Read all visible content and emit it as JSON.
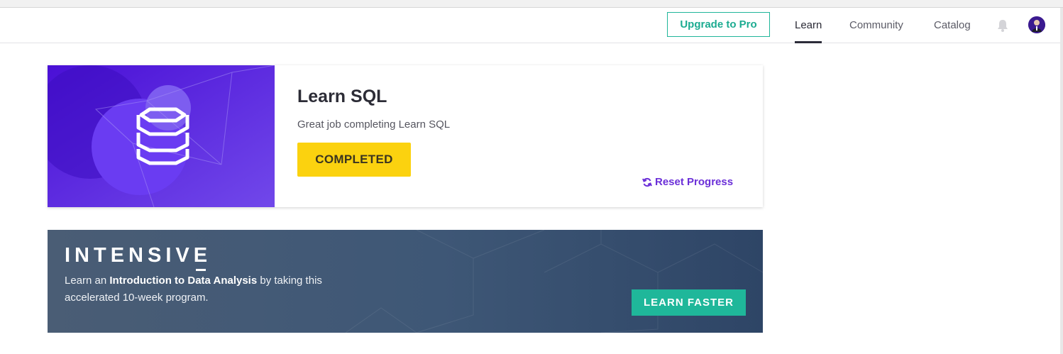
{
  "header": {
    "upgrade_label": "Upgrade to Pro",
    "nav": [
      {
        "label": "Learn",
        "active": true
      },
      {
        "label": "Community",
        "active": false
      },
      {
        "label": "Catalog",
        "active": false
      }
    ],
    "bell_icon": "bell-icon",
    "avatar_icon": "user-avatar"
  },
  "course_card": {
    "title": "Learn SQL",
    "subtitle": "Great job completing Learn SQL",
    "status_label": "COMPLETED",
    "reset_label": "Reset Progress",
    "reset_icon": "refresh-icon",
    "image_icon": "database-icon",
    "colors": {
      "status": "#fbd20f",
      "image_bg": "#5a2ee0",
      "reset": "#6b2fd8"
    }
  },
  "promo_banner": {
    "heading": "INTENSIVE",
    "text_before": "Learn an ",
    "text_bold": "Introduction to Data Analysis",
    "text_after": " by taking this accelerated 10-week program.",
    "cta_label": "LEARN FASTER",
    "colors": {
      "cta": "#1fb79a",
      "bg": "#3e5776"
    }
  },
  "colors": {
    "accent": "#1cab91"
  }
}
